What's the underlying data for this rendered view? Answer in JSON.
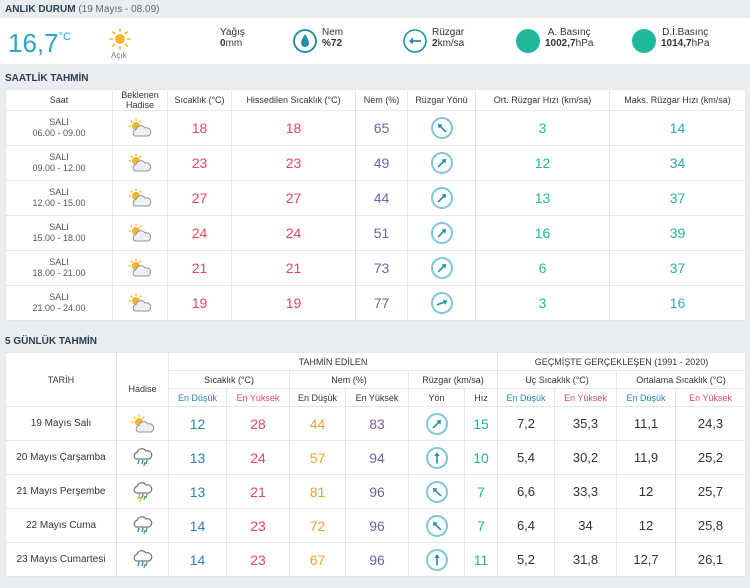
{
  "now": {
    "title": "ANLIK DURUM",
    "subtitle": "(19 Mayıs - 08.09)",
    "temperature": "16,7",
    "temperature_unit": "°C",
    "condition": "Açık",
    "precip_label": "Yağış",
    "precip_value": "0",
    "precip_unit": "mm",
    "humidity_label": "Nem",
    "humidity_value": "%72",
    "wind_label": "Rüzgar",
    "wind_value": "2",
    "wind_unit": "km/sa",
    "pressure_label": "A. Basınç",
    "pressure_value": "1002,7",
    "pressure_unit": "hPa",
    "sea_pressure_label": "D.İ.Basınç",
    "sea_pressure_value": "1014,7",
    "sea_pressure_unit": "hPa"
  },
  "hourly": {
    "title": "SAATLİK TAHMİN",
    "headers": {
      "time": "Saat",
      "expected_line1": "Beklenen",
      "expected_line2": "Hadise",
      "temp": "Sıcaklık (°C)",
      "feels": "Hissedilen Sıcaklık (°C)",
      "humidity": "Nem (%)",
      "wind_dir": "Rüzgar Yönü",
      "avg_wind": "Ort. Rüzgar Hızı (km/sa)",
      "max_wind": "Maks. Rüzgar Hızı (km/sa)"
    },
    "rows": [
      {
        "day": "SALI",
        "range": "06.00 - 09.00",
        "temp": "18",
        "feels": "18",
        "humidity": "65",
        "avg": "3",
        "max": "14",
        "dir": 135
      },
      {
        "day": "SALI",
        "range": "09.00 - 12.00",
        "temp": "23",
        "feels": "23",
        "humidity": "49",
        "avg": "12",
        "max": "34",
        "dir": 225
      },
      {
        "day": "SALI",
        "range": "12.00 - 15.00",
        "temp": "27",
        "feels": "27",
        "humidity": "44",
        "avg": "13",
        "max": "37",
        "dir": 225
      },
      {
        "day": "SALI",
        "range": "15.00 - 18.00",
        "temp": "24",
        "feels": "24",
        "humidity": "51",
        "avg": "16",
        "max": "39",
        "dir": 225
      },
      {
        "day": "SALI",
        "range": "18.00 - 21.00",
        "temp": "21",
        "feels": "21",
        "humidity": "73",
        "avg": "6",
        "max": "37",
        "dir": 225
      },
      {
        "day": "SALI",
        "range": "21.00 - 24.00",
        "temp": "19",
        "feels": "19",
        "humidity": "77",
        "avg": "3",
        "max": "16",
        "dir": 250
      }
    ]
  },
  "daily": {
    "title": "5 GÜNLÜK TAHMİN",
    "headers": {
      "forecast": "TAHMİN EDİLEN",
      "past": "GEÇMİŞTE GERÇEKLEŞEN (1991 - 2020)",
      "date": "TARİH",
      "event": "Hadise",
      "temp": "Sıcaklık (°C)",
      "humidity": "Nem (%)",
      "wind": "Rüzgar (km/sa)",
      "extreme": "Uç Sıcaklık (°C)",
      "average": "Ortalama Sıcaklık (°C)",
      "low": "En Düşük",
      "high": "En Yüksek",
      "dir": "Yön",
      "speed": "Hız"
    },
    "rows": [
      {
        "date": "19 Mayıs Salı",
        "icon": "partly-cloudy",
        "tmin": "12",
        "tmax": "28",
        "hmin": "44",
        "hmax": "83",
        "dir": 225,
        "speed": "15",
        "xmin": "7,2",
        "xmax": "35,3",
        "amin": "11,1",
        "amax": "24,3"
      },
      {
        "date": "20 Mayıs Çarşamba",
        "icon": "rain",
        "tmin": "13",
        "tmax": "24",
        "hmin": "57",
        "hmax": "94",
        "dir": 180,
        "speed": "10",
        "xmin": "5,4",
        "xmax": "30,2",
        "amin": "11,9",
        "amax": "25,2"
      },
      {
        "date": "21 Mayıs Perşembe",
        "icon": "storm",
        "tmin": "13",
        "tmax": "21",
        "hmin": "81",
        "hmax": "96",
        "dir": 135,
        "speed": "7",
        "xmin": "6,6",
        "xmax": "33,3",
        "amin": "12",
        "amax": "25,7"
      },
      {
        "date": "22 Mayıs Cuma",
        "icon": "rain",
        "tmin": "14",
        "tmax": "23",
        "hmin": "72",
        "hmax": "96",
        "dir": 135,
        "speed": "7",
        "xmin": "6,4",
        "xmax": "34",
        "amin": "12",
        "amax": "25,8"
      },
      {
        "date": "23 Mayıs Cumartesi",
        "icon": "rain",
        "tmin": "14",
        "tmax": "23",
        "hmin": "67",
        "hmax": "96",
        "dir": 180,
        "speed": "11",
        "xmin": "5,2",
        "xmax": "31,8",
        "amin": "12,7",
        "amax": "26,1"
      }
    ]
  }
}
